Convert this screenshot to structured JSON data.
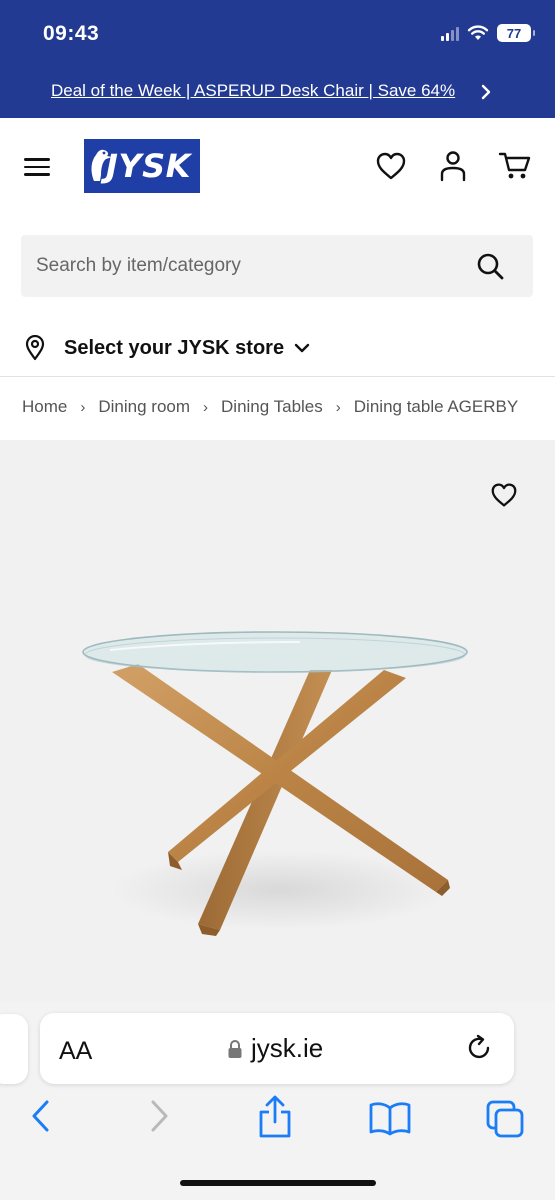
{
  "status_bar": {
    "time": "09:43",
    "battery": "77"
  },
  "promo": {
    "text": "Deal of the Week | ASPERUP Desk Chair | Save 64%"
  },
  "header": {
    "logo_text": "JYSK",
    "icons": [
      "menu-icon",
      "heart-icon",
      "user-icon",
      "cart-icon"
    ]
  },
  "search": {
    "placeholder": "Search by item/category"
  },
  "store": {
    "label": "Select your JYSK store"
  },
  "breadcrumb": {
    "items": [
      "Home",
      "Dining room",
      "Dining Tables",
      "Dining table AGERBY"
    ]
  },
  "product": {
    "image_alt": "Dining table AGERBY"
  },
  "browser": {
    "aa_label": "AA",
    "url": "jysk.ie",
    "toolbar": [
      "back-icon",
      "forward-icon",
      "share-icon",
      "bookmarks-icon",
      "tabs-icon"
    ]
  },
  "colors": {
    "brand_blue": "#233a93",
    "logo_blue": "#1f3fa6",
    "ios_blue": "#1a7cf6"
  }
}
